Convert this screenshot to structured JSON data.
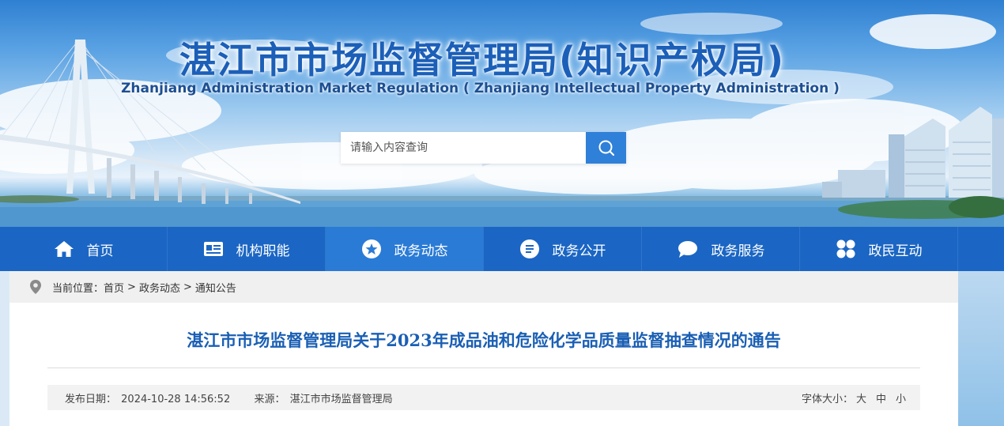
{
  "header": {
    "title": "湛江市市场监督管理局(知识产权局)",
    "subtitle": "Zhanjiang Administration Market Regulation ( Zhanjiang Intellectual Property Administration )"
  },
  "search": {
    "placeholder": "请输入内容查询",
    "button_icon": "search-icon"
  },
  "nav": {
    "items": [
      {
        "label": "首页",
        "icon": "home-icon"
      },
      {
        "label": "机构职能",
        "icon": "id-card-icon"
      },
      {
        "label": "政务动态",
        "icon": "star-icon",
        "active": true
      },
      {
        "label": "政务公开",
        "icon": "document-icon"
      },
      {
        "label": "政务服务",
        "icon": "chat-bubble-icon"
      },
      {
        "label": "政民互动",
        "icon": "grid-icon"
      }
    ]
  },
  "breadcrumb": {
    "prefix": "当前位置：",
    "items": [
      "首页",
      "政务动态",
      "通知公告"
    ],
    "separator": ">"
  },
  "article": {
    "title": "湛江市市场监督管理局关于2023年成品油和危险化学品质量监督抽查情况的通告",
    "date_label": "发布日期：",
    "date": "2024-10-28 14:56:52",
    "source_label": "来源：",
    "source": "湛江市市场监督管理局",
    "font_size_label": "字体大小：",
    "font_sizes": [
      "大",
      "中",
      "小"
    ]
  },
  "colors": {
    "nav_bg": "#1b66c4",
    "nav_active": "#2a7bd6",
    "title_blue": "#1a5fb4",
    "search_button": "#2f80d8"
  }
}
